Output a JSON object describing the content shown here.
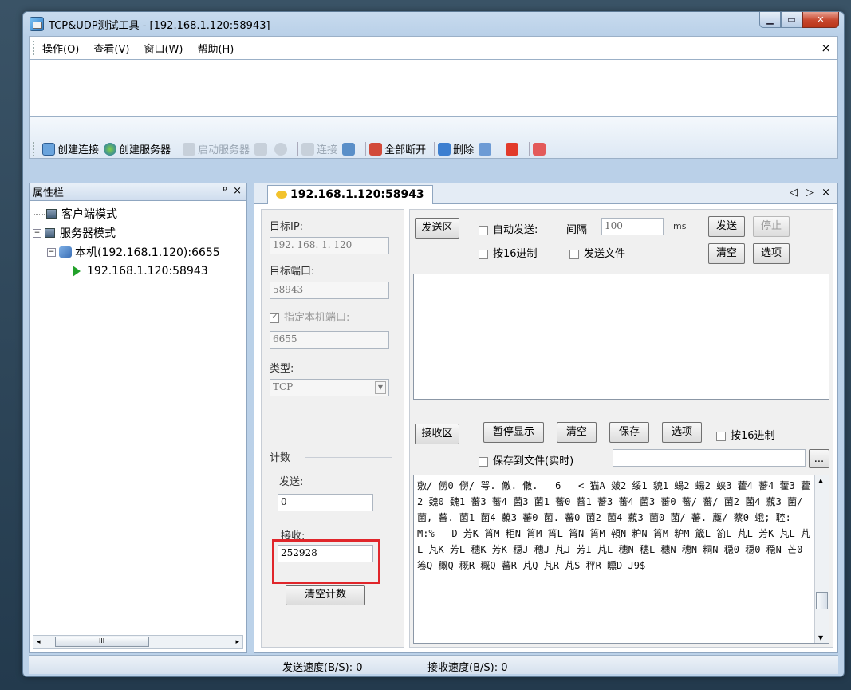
{
  "window": {
    "title": "TCP&UDP测试工具 - [192.168.1.120:58943]"
  },
  "menu": {
    "items": [
      "操作(O)",
      "查看(V)",
      "窗口(W)",
      "帮助(H)"
    ],
    "close": "×"
  },
  "toolbar": {
    "create_connection": "创建连接",
    "create_server": "创建服务器",
    "start_server": "启动服务器",
    "connect": "连接",
    "disconnect_all": "全部断开",
    "delete": "删除"
  },
  "sidebar": {
    "title": "属性栏",
    "pin": "ᵖ",
    "close": "×",
    "nodes": {
      "client_mode": "客户端模式",
      "server_mode": "服务器模式",
      "local_host": "本机(192.168.1.120):6655",
      "connection": "192.168.1.120:58943"
    },
    "scroll_thumb": "III"
  },
  "tab": {
    "label": "192.168.1.120:58943",
    "nav": "◁ ▷ ×"
  },
  "left_panel": {
    "target_ip_label": "目标IP:",
    "target_ip_value": "192. 168. 1. 120",
    "target_port_label": "目标端口:",
    "target_port_value": "58943",
    "specify_local_port_label": "指定本机端口:",
    "local_port_value": "6655",
    "type_label": "类型:",
    "type_value": "TCP",
    "count_label": "计数",
    "send_label": "发送:",
    "send_value": "0",
    "receive_label": "接收:",
    "receive_value": "252928",
    "clear_count_button": "清空计数"
  },
  "send_area": {
    "label": "发送区",
    "auto_send_label": "自动发送:",
    "interval_label": "间隔",
    "interval_value": "100",
    "interval_unit": "ms",
    "send_button": "发送",
    "stop_button": "停止",
    "hex_label": "按16进制",
    "send_file_label": "发送文件",
    "clear_button": "清空",
    "options_button": "选项"
  },
  "receive_area": {
    "label": "接收区",
    "pause_button": "暂停显示",
    "clear_button": "清空",
    "save_button": "保存",
    "options_button": "选项",
    "hex_label": "按16进制",
    "save_to_file_label": "保存到文件(实时)",
    "browse_button": "...",
    "content": "敷/ 僗0 僗/ 咢. 僌. 僌.   6   < 猫A 皴2 绥1 貌1 蝪2 蝪2 蛱3 藿4 蕃4 藿3 藿2 魏0 魏1 蕃3 蕃4 菌3 菌1 蕃0 蕃1 蕃3 蕃4 菌3 蕃0 蕃/ 蕃/ 菌2 菌4 藽3 菌/ 菌, 蕃. 菌1 菌4 藽3 蕃0 菌. 蕃0 菌2 菌4 藽3 菌0 菌/ 蕃. 蘪/ 蔡0 蛾; 聜: M:%   D 芳K 筲M 粔N 筲M 筲L 筲N 筲M 顇N 粐N 筲M 粐M 箴L 箚L 芃L 芳K 芃L 芃L 芃K 芳L 穗K 芳K 穏J 穗J 芃J 芳I 芃L 穗N 穗L 穗N 穗N 粡N 穏0 穏0 穏N 芒0 箞Q 穊Q 穊R 穊Q 蕃R 芃Q 芃R 芃S 秤R 矄D J9$"
  },
  "status": {
    "send_speed": "发送速度(B/S): 0",
    "receive_speed": "接收速度(B/S): 0"
  }
}
